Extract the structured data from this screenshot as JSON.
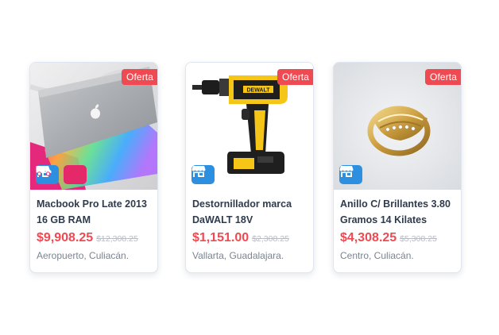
{
  "offer_label": "Oferta",
  "colors": {
    "offer_badge": "#ef4a52",
    "price": "#ef4a52",
    "store_icon": "#2c8fdf",
    "shipping_icon": "#e4286a"
  },
  "products": [
    {
      "title": "Macbook Pro Late 2013 16 GB RAM",
      "price": "$9,908.25",
      "old_price": "$12,308.25",
      "location": "Aeropuerto, Culiacán.",
      "image": "macbook-laptop",
      "icons": [
        "store-icon",
        "truck-icon"
      ]
    },
    {
      "title": "Destornillador marca DaWALT 18V",
      "price": "$1,151.00",
      "old_price": "$2,308.25",
      "location": "Vallarta, Guadalajara.",
      "image": "power-drill",
      "icons": [
        "store-icon"
      ]
    },
    {
      "title": "Anillo C/ Brillantes 3.80 Gramos 14 Kilates",
      "price": "$4,308.25",
      "old_price": "$5,308.25",
      "location": "Centro, Culiacán.",
      "image": "gold-ring",
      "icons": [
        "store-icon"
      ]
    }
  ]
}
